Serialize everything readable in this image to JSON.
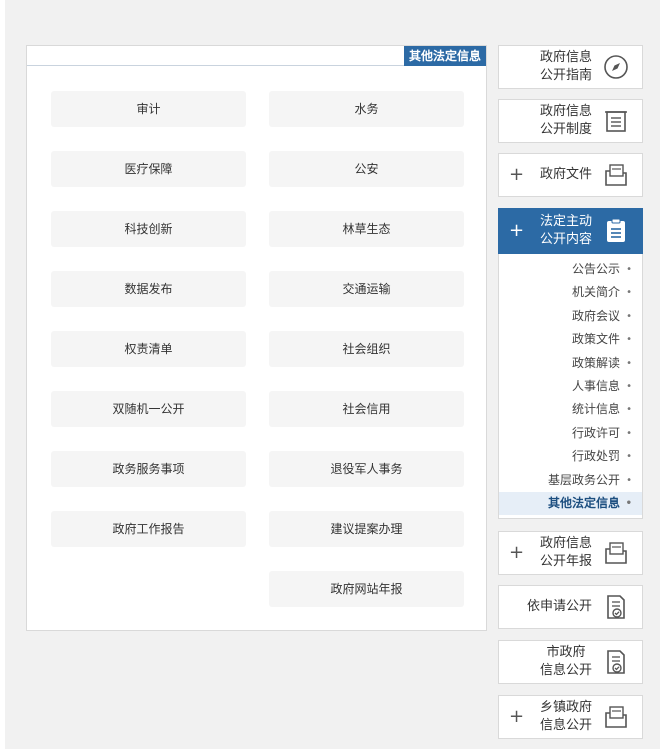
{
  "panel": {
    "title": "其他法定信息",
    "categories": [
      [
        "水务",
        "审计"
      ],
      [
        "公安",
        "医疗保障"
      ],
      [
        "林草生态",
        "科技创新"
      ],
      [
        "交通运输",
        "数据发布"
      ],
      [
        "社会组织",
        "权责清单"
      ],
      [
        "社会信用",
        "双随机一公开"
      ],
      [
        "退役军人事务",
        "政务服务事项"
      ],
      [
        "建议提案办理",
        "政府工作报告"
      ],
      [
        "政府网站年报"
      ]
    ]
  },
  "sidebar": {
    "items": [
      {
        "label": "政府信息\n公开指南",
        "icon": "compass-icon",
        "expandable": false
      },
      {
        "label": "政府信息\n公开制度",
        "icon": "document-list-icon",
        "expandable": false
      },
      {
        "label": "政府文件",
        "icon": "folder-doc-icon",
        "expandable": true
      },
      {
        "label": "法定主动\n公开内容",
        "icon": "clipboard-icon",
        "expandable": true,
        "active": true
      },
      {
        "label": "政府信息\n公开年报",
        "icon": "folder-doc-icon",
        "expandable": true
      },
      {
        "label": "依申请公开",
        "icon": "doc-check-icon",
        "expandable": false
      },
      {
        "label": "市政府\n信息公开",
        "icon": "doc-check-icon",
        "expandable": false
      },
      {
        "label": "乡镇政府\n信息公开",
        "icon": "folder-doc-icon",
        "expandable": true
      }
    ],
    "sub_items": [
      "公告公示",
      "机关简介",
      "政府会议",
      "政策文件",
      "政策解读",
      "人事信息",
      "统计信息",
      "行政许可",
      "行政处罚",
      "基层政务公开",
      "其他法定信息"
    ],
    "current_sub": "其他法定信息",
    "plus_symbol": "+"
  },
  "colors": {
    "accent": "#2c6aa5",
    "tile_bg": "#f5f5f5",
    "page_bg": "#f1f1f1"
  }
}
